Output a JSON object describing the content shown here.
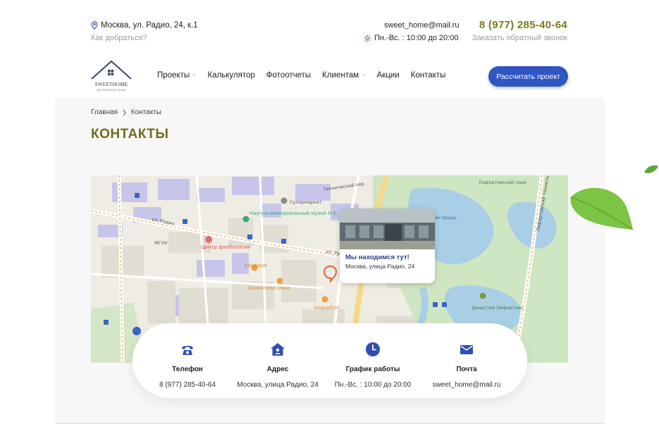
{
  "topbar": {
    "address": "Москва, ул. Радио, 24, к.1",
    "how_to_get": "Как добраться?",
    "email": "sweet_home@mail.ru",
    "hours": "Пн.-Вс. : 10:00 до 20:00",
    "phone": "8 (977) 285-40-64",
    "callback": "Заказать обратный звонок"
  },
  "logo": {
    "name": "SWEETHOME",
    "tagline": "ДЕРЕВЯННЫЕ ДОМА"
  },
  "nav": {
    "items": [
      {
        "label": "Проекты",
        "dropdown": true
      },
      {
        "label": "Калькулятор",
        "dropdown": false
      },
      {
        "label": "Фотоотчеты",
        "dropdown": false
      },
      {
        "label": "Клиентам",
        "dropdown": true
      },
      {
        "label": "Акции",
        "dropdown": false
      },
      {
        "label": "Контакты",
        "dropdown": false
      }
    ],
    "cta": "Рассчитать проект"
  },
  "breadcrumb": {
    "home": "Главная",
    "current": "Контакты"
  },
  "page_title": "КОНТАКТЫ",
  "map": {
    "popup_title": "Мы находимся тут!",
    "popup_address": "Москва, улица Радио, 24",
    "labels": {
      "tech_lane": "Технический пер.",
      "radio_st": "ул. Радио",
      "radio_st2": "ул. Радио",
      "museum": "Научно-мемориальный музей Н.Е.",
      "supermarket": "Супермаркет",
      "center": "Центр флебологии",
      "kalabasa": "Kalabasa",
      "aroma": "Ароматная река",
      "anderson": "АндерСон",
      "mgou": "МГОУ",
      "lef_ponds": "Лефортовские пруды",
      "lef_park": "Лефортовский парк",
      "lef_tunnel": "Лефортовский тоннель",
      "dynasty": "Династия Лефортово"
    }
  },
  "contacts": {
    "phone_label": "Телефон",
    "phone_value": "8 (977) 285-40-64",
    "address_label": "Адрес",
    "address_value": "Москва, улица Радио, 24",
    "hours_label": "График работы",
    "hours_value": "Пн.-Вс. : 10:00 до 20:00",
    "mail_label": "Почта",
    "mail_value": "sweet_home@mail.ru"
  },
  "colors": {
    "accent_olive": "#7c7a1c",
    "button_blue": "#2f56c2",
    "icon_blue": "#2f4fb0"
  }
}
